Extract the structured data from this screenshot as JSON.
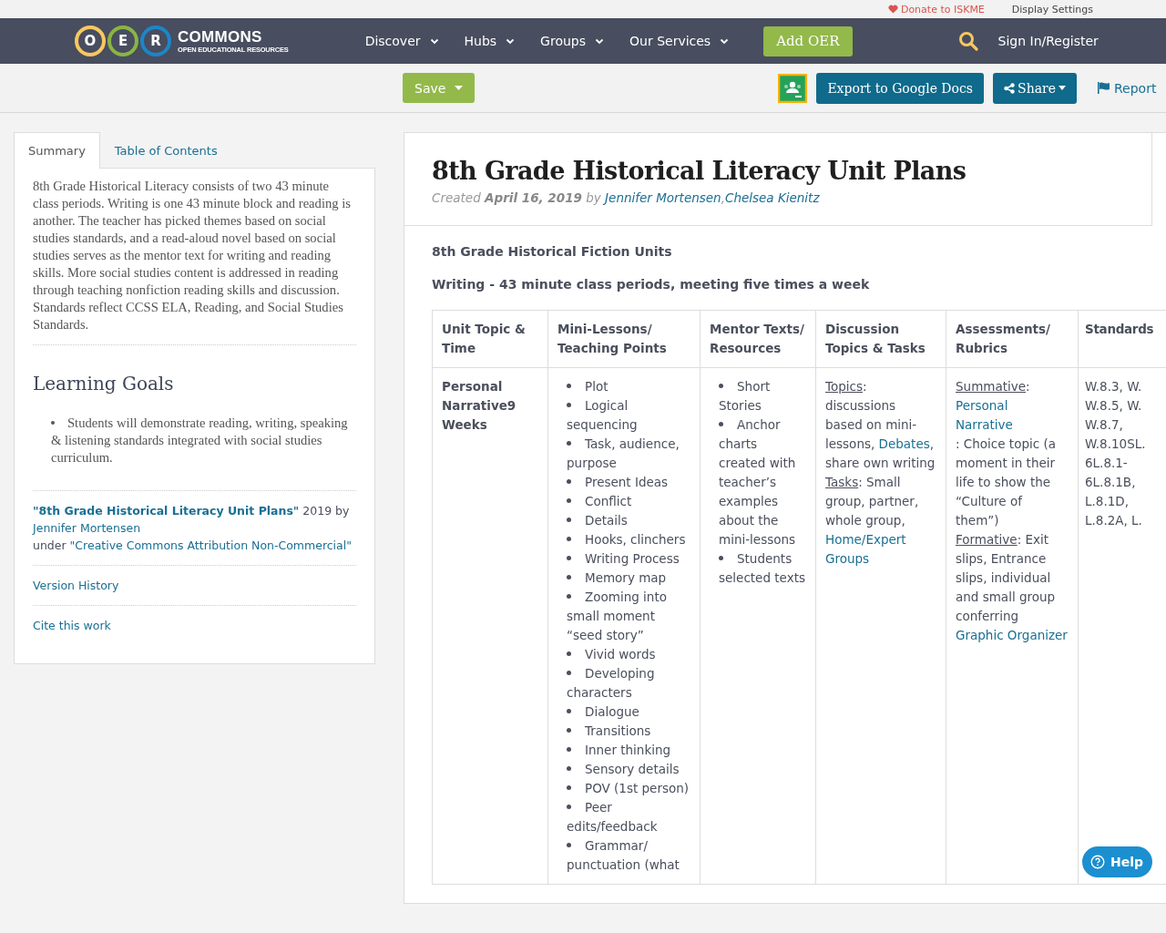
{
  "utility_bar": {
    "donate": "Donate to ISKME",
    "display_settings": "Display Settings"
  },
  "logo": {
    "letters": [
      {
        "text": "O",
        "color": "#f6c85f"
      },
      {
        "text": "E",
        "color": "#8bb443"
      },
      {
        "text": "R",
        "color": "#1c86c8"
      }
    ],
    "name": "COMMONS",
    "tagline": "OPEN EDUCATIONAL RESOURCES"
  },
  "nav": {
    "items": [
      {
        "label": "Discover",
        "dropdown": true
      },
      {
        "label": "Hubs",
        "dropdown": true
      },
      {
        "label": "Groups",
        "dropdown": true
      },
      {
        "label": "Our Services",
        "dropdown": true
      }
    ],
    "add_button": "Add OER",
    "sign_in": "Sign In/Register"
  },
  "toolbar": {
    "save": "Save",
    "export": "Export to Google Docs",
    "share": "Share",
    "report": "Report"
  },
  "sidebar": {
    "tabs": [
      {
        "label": "Summary",
        "selected": true
      },
      {
        "label": "Table of Contents",
        "selected": false
      }
    ],
    "summary": "8th Grade Historical Literacy consists of two 43 minute class periods. Writing is one 43 minute block and reading is another. The teacher has picked themes based on social studies standards, and a read-aloud novel based on social studies serves as the mentor text for writing and reading skills. More social studies content is addressed in reading through teaching nonfiction reading skills and discussion. Standards reflect CCSS ELA, Reading, and Social Studies Standards.",
    "goals_heading": "Learning Goals",
    "goals": [
      "Students will demonstrate reading, writing, speaking & listening standards integrated with social studies curriculum."
    ],
    "citation": [
      [
        {
          "kind": "strong_link",
          "text": "\"8th Grade Historical Literacy Unit Plans\""
        },
        {
          "kind": "text",
          "text": " 2019 by "
        },
        {
          "kind": "link",
          "text": "Jennifer Mortensen"
        }
      ],
      [
        {
          "kind": "text",
          "text": "under "
        },
        {
          "kind": "link",
          "text": "\"Creative Commons Attribution Non-Commercial\""
        }
      ]
    ],
    "links": [
      "Version History",
      "Cite this work"
    ]
  },
  "resource": {
    "title": "8th Grade Historical Literacy Unit Plans",
    "created_label": "Created",
    "date": "April 16, 2019",
    "by": "by",
    "authors": [
      "Jennifer Mortensen",
      "Chelsea Kienitz"
    ],
    "author_separator": ",",
    "headings": [
      "8th Grade Historical Fiction Units",
      "Writing - 43 minute class periods, meeting five times a week"
    ],
    "table": {
      "columns": [
        "Unit Topic & Time",
        "Mini-Lessons/ Teaching Points",
        "Mentor Texts/ Resources",
        "Discussion Topics & Tasks",
        "Assessments/ Rubrics",
        "Standards"
      ],
      "rows": [
        {
          "cells": [
            {
              "kind": "bold",
              "text": "Personal Narrative9 Weeks"
            },
            {
              "kind": "bullets",
              "items": [
                "Plot",
                "Logical sequencing",
                "Task, audience, purpose",
                "Present Ideas",
                "Conflict",
                "Details",
                "Hooks, clinchers",
                "Writing Process",
                "Memory map",
                "Zooming into small moment “seed story”",
                "Vivid words",
                "Developing characters",
                "Dialogue",
                "Transitions",
                "Inner thinking",
                "Sensory details",
                "POV (1st person)",
                "Peer edits/feedback",
                "Grammar/ punctuation (what"
              ]
            },
            {
              "kind": "bullets",
              "items": [
                "Short Stories",
                "Anchor charts created with teacher’s examples about the mini-lessons",
                "Students selected texts"
              ]
            },
            {
              "kind": "rich",
              "paragraphs": [
                [
                  {
                    "kind": "label",
                    "text": "Topics"
                  },
                  {
                    "kind": "text",
                    "text": ": discussions based on mini-lessons, "
                  },
                  {
                    "kind": "link",
                    "text": "Debates"
                  },
                  {
                    "kind": "text",
                    "text": ", share own writing"
                  }
                ],
                [
                  {
                    "kind": "label",
                    "text": "Tasks"
                  },
                  {
                    "kind": "text",
                    "text": ":  Small group, partner, whole group, "
                  },
                  {
                    "kind": "link",
                    "text": "Home/Expert Groups"
                  }
                ]
              ]
            },
            {
              "kind": "rich",
              "paragraphs": [
                [
                  {
                    "kind": "label",
                    "text": "Summative"
                  },
                  {
                    "kind": "text",
                    "text": ": "
                  },
                  {
                    "kind": "link",
                    "text": "Personal Narrative"
                  },
                  {
                    "kind": "text",
                    "text": ": Choice topic (a moment in their life to show the “Culture of them”)"
                  }
                ],
                [
                  {
                    "kind": "label",
                    "text": "Formative"
                  },
                  {
                    "kind": "text",
                    "text": ": Exit slips, Entrance slips, individual and small group conferring"
                  },
                  {
                    "kind": "link",
                    "text": "Graphic Organizer"
                  }
                ]
              ]
            },
            {
              "kind": "lines",
              "lines": [
                "W.8.3, W.",
                "W.8.5, W.",
                "W.8.7,",
                "W.8.10SL.",
                "6L.8.1-",
                "6L.8.1B,",
                "L.8.1D,",
                "L.8.2A, L."
              ]
            }
          ]
        }
      ]
    }
  },
  "help": "Help"
}
